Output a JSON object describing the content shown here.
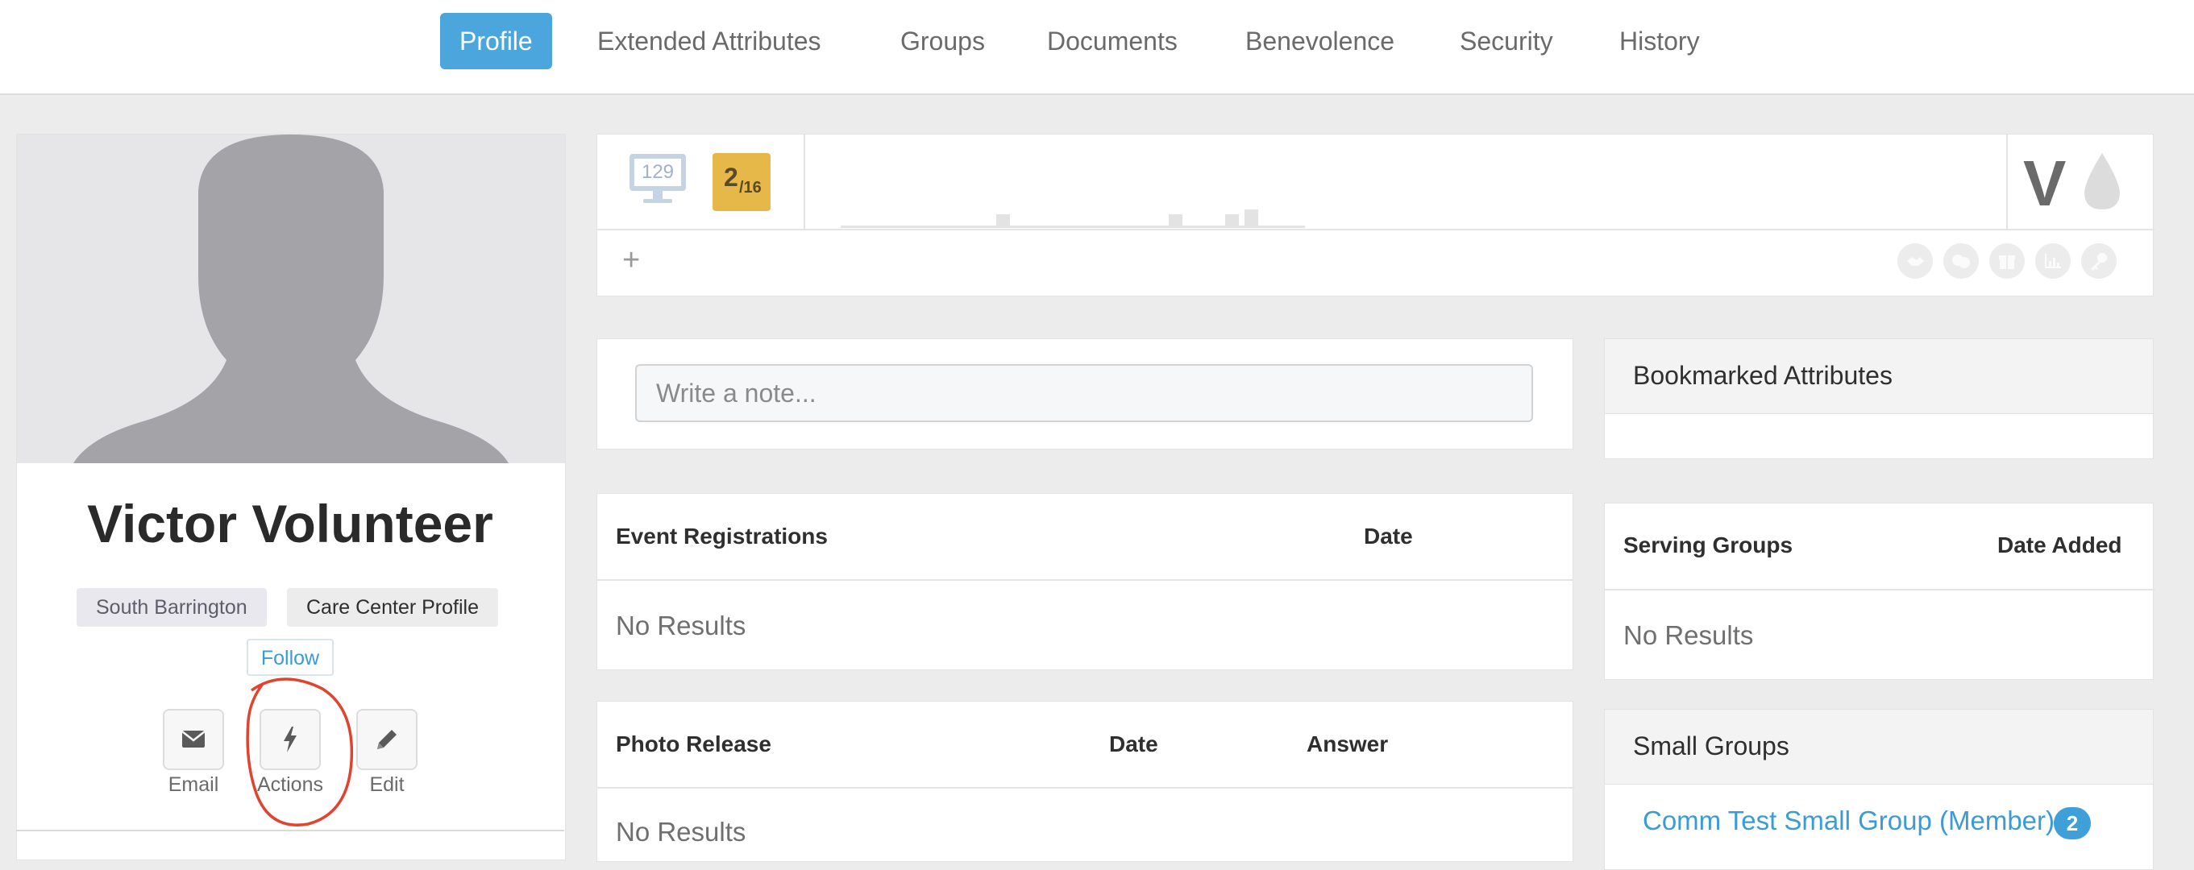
{
  "tabs": [
    {
      "label": "Profile",
      "active": true
    },
    {
      "label": "Extended Attributes",
      "active": false
    },
    {
      "label": "Groups",
      "active": false
    },
    {
      "label": "Documents",
      "active": false
    },
    {
      "label": "Benevolence",
      "active": false
    },
    {
      "label": "Security",
      "active": false
    },
    {
      "label": "History",
      "active": false
    }
  ],
  "person": {
    "name": "Victor Volunteer",
    "campus_tag": "South Barrington",
    "profile_tag": "Care Center Profile",
    "follow_label": "Follow"
  },
  "actions": [
    {
      "label": "Email",
      "icon": "envelope-icon"
    },
    {
      "label": "Actions",
      "icon": "bolt-icon",
      "annotated": true
    },
    {
      "label": "Edit",
      "icon": "pencil-icon"
    }
  ],
  "summary": {
    "monitor_count": "129",
    "badge_main": "2",
    "badge_sub": "/16",
    "letter_badge": "V",
    "add_symbol": "+",
    "badge_icons": [
      "handshake-icon",
      "masks-icon",
      "gift-icon",
      "chart-icon",
      "key-icon"
    ]
  },
  "note": {
    "placeholder": "Write a note..."
  },
  "event_registrations": {
    "col1": "Event Registrations",
    "col2": "Date",
    "empty": "No Results"
  },
  "photo_release": {
    "col1": "Photo Release",
    "col2": "Date",
    "col3": "Answer",
    "empty": "No Results"
  },
  "bookmarked": {
    "title": "Bookmarked Attributes"
  },
  "serving_groups": {
    "col1": "Serving Groups",
    "col2": "Date Added",
    "empty": "No Results"
  },
  "small_groups": {
    "title": "Small Groups",
    "item": "Comm Test Small Group (Member)",
    "count": "2"
  },
  "colors": {
    "accent": "#4aa6dc",
    "gold_badge": "#e6b84a",
    "annotation": "#e0432e"
  }
}
